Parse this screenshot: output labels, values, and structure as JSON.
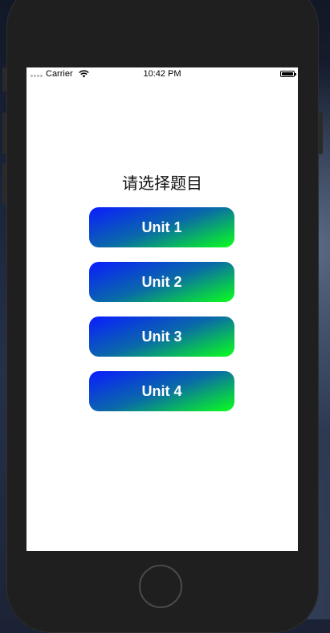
{
  "status_bar": {
    "carrier": "Carrier",
    "time": "10:42 PM",
    "icons": [
      "signal-dots-icon",
      "wifi-icon",
      "battery-icon"
    ]
  },
  "main": {
    "title": "请选择题目",
    "buttons": [
      {
        "label": "Unit 1"
      },
      {
        "label": "Unit 2"
      },
      {
        "label": "Unit 3"
      },
      {
        "label": "Unit 4"
      }
    ]
  },
  "colors": {
    "button_gradient_start": "#0a1cff",
    "button_gradient_end": "#0aff1c",
    "button_text": "#ffffff",
    "screen_background": "#ffffff",
    "device_frame": "#1f1f1f"
  }
}
